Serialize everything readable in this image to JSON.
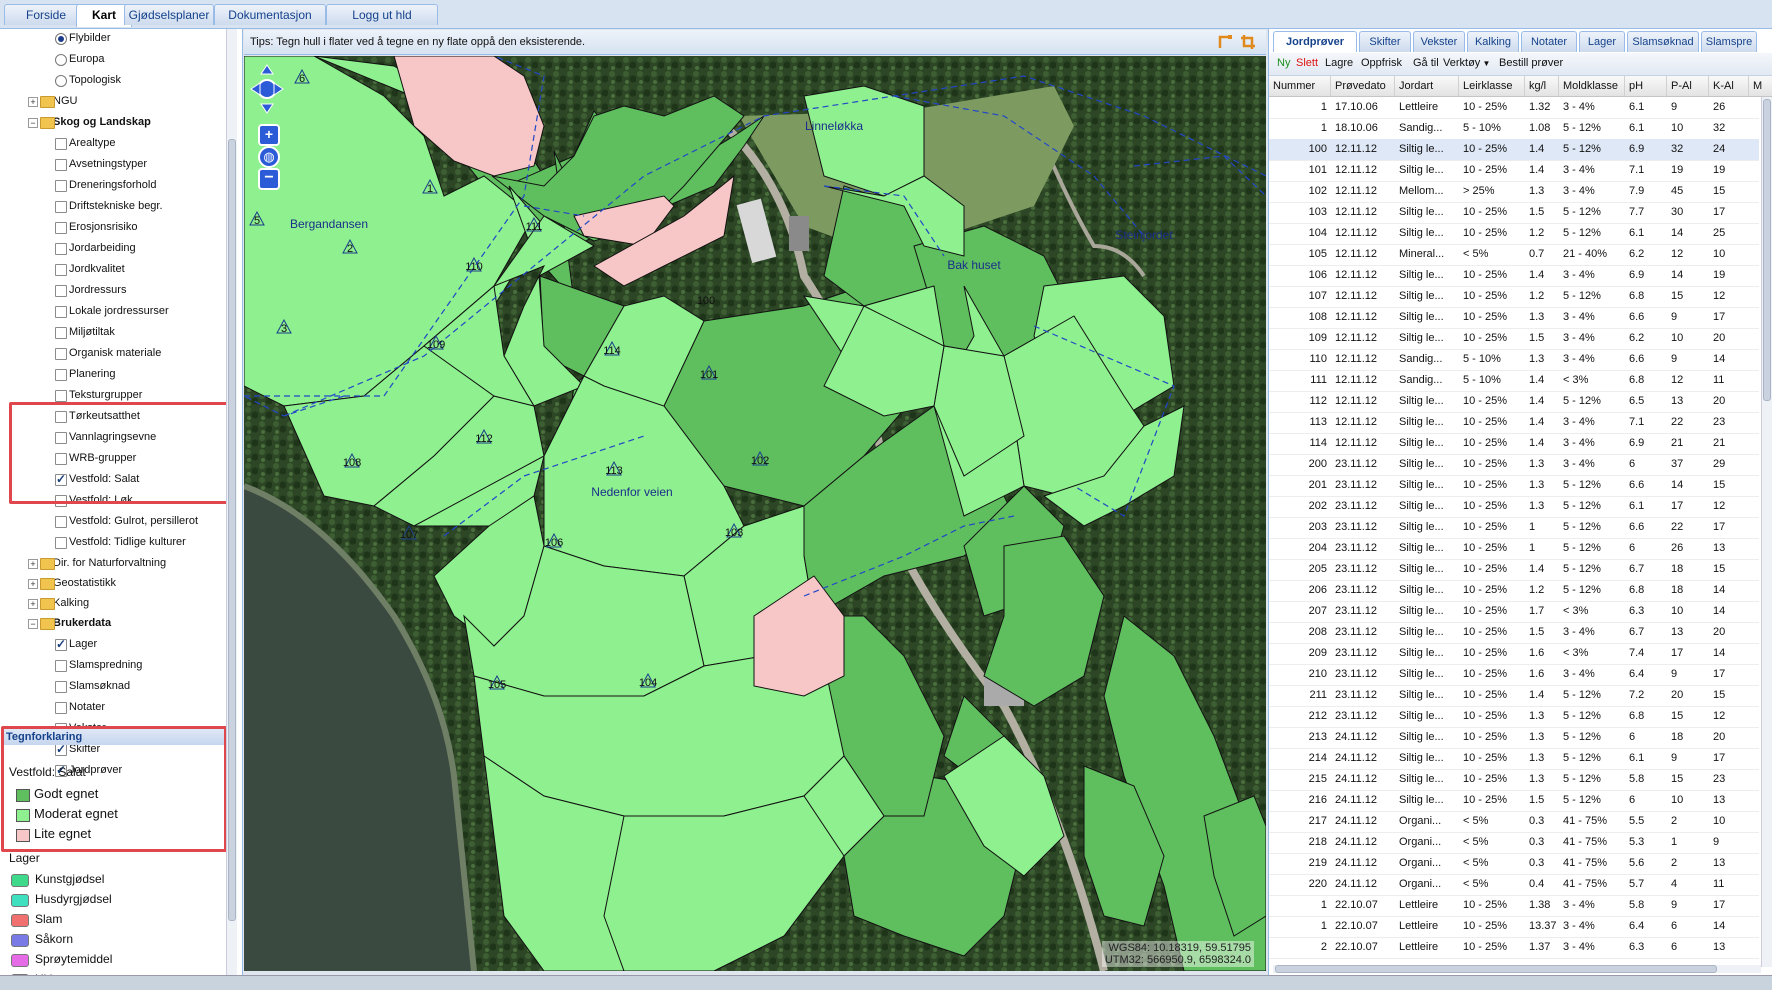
{
  "top_tabs": [
    {
      "label": "Forside"
    },
    {
      "label": "Kart"
    },
    {
      "label": "Gjødselsplaner"
    },
    {
      "label": "Dokumentasjon"
    },
    {
      "label": "Logg ut hld"
    }
  ],
  "tree": {
    "radios": [
      {
        "label": "Flybilder",
        "selected": true
      },
      {
        "label": "Europa",
        "selected": false
      },
      {
        "label": "Topologisk",
        "selected": false
      }
    ],
    "ngu": "NGU",
    "skog": "Skog og Landskap",
    "skog_items": [
      {
        "label": "Arealtype",
        "checked": false
      },
      {
        "label": "Avsetningstyper",
        "checked": false
      },
      {
        "label": "Dreneringsforhold",
        "checked": false
      },
      {
        "label": "Driftstekniske begr.",
        "checked": false
      },
      {
        "label": "Erosjonsrisiko",
        "checked": false
      },
      {
        "label": "Jordarbeiding",
        "checked": false
      },
      {
        "label": "Jordkvalitet",
        "checked": false
      },
      {
        "label": "Jordressurs",
        "checked": false
      },
      {
        "label": "Lokale jordressurser",
        "checked": false
      },
      {
        "label": "Miljøtiltak",
        "checked": false
      },
      {
        "label": "Organisk materiale",
        "checked": false
      },
      {
        "label": "Planering",
        "checked": false
      },
      {
        "label": "Teksturgrupper",
        "checked": false
      },
      {
        "label": "Tørkeutsatthet",
        "checked": false
      },
      {
        "label": "Vannlagringsevne",
        "checked": false
      },
      {
        "label": "WRB-grupper",
        "checked": false
      },
      {
        "label": "Vestfold: Salat",
        "checked": true
      },
      {
        "label": "Vestfold: Løk",
        "checked": false
      },
      {
        "label": "Vestfold: Gulrot, persillerot",
        "checked": false
      },
      {
        "label": "Vestfold: Tidlige kulturer",
        "checked": false
      }
    ],
    "other_folders": [
      "Dir. for Naturforvaltning",
      "Geostatistikk",
      "Kalking"
    ],
    "brukerdata": "Brukerdata",
    "brukerdata_items": [
      {
        "label": "Lager",
        "checked": true
      },
      {
        "label": "Slamspredning",
        "checked": false
      },
      {
        "label": "Slamsøknad",
        "checked": false
      },
      {
        "label": "Notater",
        "checked": false
      },
      {
        "label": "Vekster",
        "checked": false
      },
      {
        "label": "Skifter",
        "checked": true
      },
      {
        "label": "Jordprøver",
        "checked": true
      }
    ]
  },
  "legend": {
    "title": "Tegnforklaring",
    "subtitle": "Vestfold: Salat",
    "items": [
      {
        "label": "Godt egnet",
        "color": "#5fbf5f"
      },
      {
        "label": "Moderat egnet",
        "color": "#8ef08e"
      },
      {
        "label": "Lite egnet",
        "color": "#f7c6c6"
      }
    ],
    "lager_title": "Lager",
    "lager_items": [
      {
        "label": "Kunstgjødsel",
        "color": "#3ed98a"
      },
      {
        "label": "Husdyrgjødsel",
        "color": "#3ee0c0"
      },
      {
        "label": "Slam",
        "color": "#f07070"
      },
      {
        "label": "Såkorn",
        "color": "#7a7ae6"
      },
      {
        "label": "Sprøytemiddel",
        "color": "#e66be6"
      },
      {
        "label": "Ukjent",
        "color": "#ffffff"
      }
    ]
  },
  "map": {
    "tip": "Tips: Tegn hull i flater ved å tegne en ny flate oppå den eksisterende.",
    "place_labels": [
      "Linneløkka",
      "Bergandansen",
      "Steinjordet",
      "Bak huset",
      "Nedenfor veien"
    ],
    "field_numbers": [
      "6",
      "1",
      "5",
      "2",
      "3",
      "111",
      "110",
      "100",
      "109",
      "114",
      "101",
      "112",
      "113",
      "102",
      "108",
      "107",
      "106",
      "103",
      "105",
      "104"
    ],
    "coords_line1": "WGS84: 10.18319, 59.51795",
    "coords_line2": "UTM32: 566950.9, 6598324.0",
    "colors": {
      "godt": "#5fbf5f",
      "moderat": "#8ef08e",
      "lite": "#f7c6c6"
    }
  },
  "right": {
    "tabs": [
      "Jordprøver",
      "Skifter",
      "Vekster",
      "Kalking",
      "Notater",
      "Lager",
      "Slamsøknad",
      "Slamspre"
    ],
    "toolbar": {
      "ny": "Ny",
      "slett": "Slett",
      "lagre": "Lagre",
      "oppfrisk": "Oppfrisk",
      "gaa_til": "Gå til",
      "verktoy": "Verktøy",
      "bestill": "Bestill prøver"
    },
    "columns": [
      "Nummer",
      "Prøvedato",
      "Jordart",
      "Leirklasse",
      "kg/l",
      "Moldklasse",
      "pH",
      "P-Al",
      "K-Al",
      "M"
    ],
    "rows": [
      [
        "1",
        "17.10.06",
        "Lettleire",
        "10 - 25%",
        "1.32",
        "3 - 4%",
        "6.1",
        "9",
        "26"
      ],
      [
        "1",
        "18.10.06",
        "Sandig...",
        "5 - 10%",
        "1.08",
        "5 - 12%",
        "6.1",
        "10",
        "32"
      ],
      [
        "100",
        "12.11.12",
        "Siltig le...",
        "10 - 25%",
        "1.4",
        "5 - 12%",
        "6.9",
        "32",
        "24"
      ],
      [
        "101",
        "12.11.12",
        "Siltig le...",
        "10 - 25%",
        "1.4",
        "3 - 4%",
        "7.1",
        "19",
        "19"
      ],
      [
        "102",
        "12.11.12",
        "Mellom...",
        "> 25%",
        "1.3",
        "3 - 4%",
        "7.9",
        "45",
        "15"
      ],
      [
        "103",
        "12.11.12",
        "Siltig le...",
        "10 - 25%",
        "1.5",
        "5 - 12%",
        "7.7",
        "30",
        "17"
      ],
      [
        "104",
        "12.11.12",
        "Siltig le...",
        "10 - 25%",
        "1.2",
        "5 - 12%",
        "6.1",
        "14",
        "25"
      ],
      [
        "105",
        "12.11.12",
        "Mineral...",
        "< 5%",
        "0.7",
        "21 - 40%",
        "6.2",
        "12",
        "10"
      ],
      [
        "106",
        "12.11.12",
        "Siltig le...",
        "10 - 25%",
        "1.4",
        "3 - 4%",
        "6.9",
        "14",
        "19"
      ],
      [
        "107",
        "12.11.12",
        "Siltig le...",
        "10 - 25%",
        "1.2",
        "5 - 12%",
        "6.8",
        "15",
        "12"
      ],
      [
        "108",
        "12.11.12",
        "Siltig le...",
        "10 - 25%",
        "1.3",
        "3 - 4%",
        "6.6",
        "9",
        "17"
      ],
      [
        "109",
        "12.11.12",
        "Siltig le...",
        "10 - 25%",
        "1.5",
        "3 - 4%",
        "6.2",
        "10",
        "20"
      ],
      [
        "110",
        "12.11.12",
        "Sandig...",
        "5 - 10%",
        "1.3",
        "3 - 4%",
        "6.6",
        "9",
        "14"
      ],
      [
        "111",
        "12.11.12",
        "Sandig...",
        "5 - 10%",
        "1.4",
        "< 3%",
        "6.8",
        "12",
        "11"
      ],
      [
        "112",
        "12.11.12",
        "Siltig le...",
        "10 - 25%",
        "1.4",
        "5 - 12%",
        "6.5",
        "13",
        "20"
      ],
      [
        "113",
        "12.11.12",
        "Siltig le...",
        "10 - 25%",
        "1.4",
        "3 - 4%",
        "7.1",
        "22",
        "23"
      ],
      [
        "114",
        "12.11.12",
        "Siltig le...",
        "10 - 25%",
        "1.4",
        "3 - 4%",
        "6.9",
        "21",
        "21"
      ],
      [
        "200",
        "23.11.12",
        "Siltig le...",
        "10 - 25%",
        "1.3",
        "3 - 4%",
        "6",
        "37",
        "29"
      ],
      [
        "201",
        "23.11.12",
        "Siltig le...",
        "10 - 25%",
        "1.3",
        "5 - 12%",
        "6.6",
        "14",
        "15"
      ],
      [
        "202",
        "23.11.12",
        "Siltig le...",
        "10 - 25%",
        "1.3",
        "5 - 12%",
        "6.1",
        "17",
        "12"
      ],
      [
        "203",
        "23.11.12",
        "Siltig le...",
        "10 - 25%",
        "1",
        "5 - 12%",
        "6.6",
        "22",
        "17"
      ],
      [
        "204",
        "23.11.12",
        "Siltig le...",
        "10 - 25%",
        "1",
        "5 - 12%",
        "6",
        "26",
        "13"
      ],
      [
        "205",
        "23.11.12",
        "Siltig le...",
        "10 - 25%",
        "1.4",
        "5 - 12%",
        "6.7",
        "18",
        "15"
      ],
      [
        "206",
        "23.11.12",
        "Siltig le...",
        "10 - 25%",
        "1.2",
        "5 - 12%",
        "6.8",
        "18",
        "14"
      ],
      [
        "207",
        "23.11.12",
        "Siltig le...",
        "10 - 25%",
        "1.7",
        "< 3%",
        "6.3",
        "10",
        "14"
      ],
      [
        "208",
        "23.11.12",
        "Siltig le...",
        "10 - 25%",
        "1.5",
        "3 - 4%",
        "6.7",
        "13",
        "20"
      ],
      [
        "209",
        "23.11.12",
        "Siltig le...",
        "10 - 25%",
        "1.6",
        "< 3%",
        "7.4",
        "17",
        "14"
      ],
      [
        "210",
        "23.11.12",
        "Siltig le...",
        "10 - 25%",
        "1.6",
        "3 - 4%",
        "6.4",
        "9",
        "17"
      ],
      [
        "211",
        "23.11.12",
        "Siltig le...",
        "10 - 25%",
        "1.4",
        "5 - 12%",
        "7.2",
        "20",
        "15"
      ],
      [
        "212",
        "23.11.12",
        "Siltig le...",
        "10 - 25%",
        "1.3",
        "5 - 12%",
        "6.8",
        "15",
        "12"
      ],
      [
        "213",
        "24.11.12",
        "Siltig le...",
        "10 - 25%",
        "1.3",
        "5 - 12%",
        "6",
        "18",
        "20"
      ],
      [
        "214",
        "24.11.12",
        "Siltig le...",
        "10 - 25%",
        "1.3",
        "5 - 12%",
        "6.1",
        "9",
        "17"
      ],
      [
        "215",
        "24.11.12",
        "Siltig le...",
        "10 - 25%",
        "1.3",
        "5 - 12%",
        "5.8",
        "15",
        "23"
      ],
      [
        "216",
        "24.11.12",
        "Siltig le...",
        "10 - 25%",
        "1.5",
        "5 - 12%",
        "6",
        "10",
        "13"
      ],
      [
        "217",
        "24.11.12",
        "Organi...",
        "< 5%",
        "0.3",
        "41 - 75%",
        "5.5",
        "2",
        "10"
      ],
      [
        "218",
        "24.11.12",
        "Organi...",
        "< 5%",
        "0.3",
        "41 - 75%",
        "5.3",
        "1",
        "9"
      ],
      [
        "219",
        "24.11.12",
        "Organi...",
        "< 5%",
        "0.3",
        "41 - 75%",
        "5.6",
        "2",
        "13"
      ],
      [
        "220",
        "24.11.12",
        "Organi...",
        "< 5%",
        "0.4",
        "41 - 75%",
        "5.7",
        "4",
        "11"
      ],
      [
        "1",
        "22.10.07",
        "Lettleire",
        "10 - 25%",
        "1.38",
        "3 - 4%",
        "5.8",
        "9",
        "17"
      ],
      [
        "1",
        "22.10.07",
        "Lettleire",
        "10 - 25%",
        "13.37",
        "3 - 4%",
        "6.4",
        "6",
        "14"
      ],
      [
        "2",
        "22.10.07",
        "Lettleire",
        "10 - 25%",
        "1.37",
        "3 - 4%",
        "6.3",
        "6",
        "13"
      ]
    ],
    "selected_row": 2
  }
}
